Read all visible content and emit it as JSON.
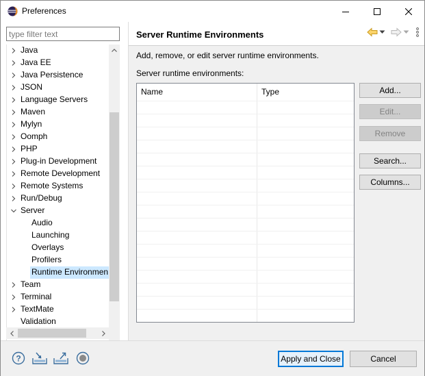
{
  "window": {
    "title": "Preferences",
    "accent": "#0078d7"
  },
  "filter": {
    "placeholder": "type filter text",
    "value": ""
  },
  "tree": {
    "items": [
      {
        "label": "Java",
        "expandable": true
      },
      {
        "label": "Java EE",
        "expandable": true
      },
      {
        "label": "Java Persistence",
        "expandable": true
      },
      {
        "label": "JSON",
        "expandable": true
      },
      {
        "label": "Language Servers",
        "expandable": true
      },
      {
        "label": "Maven",
        "expandable": true
      },
      {
        "label": "Mylyn",
        "expandable": true
      },
      {
        "label": "Oomph",
        "expandable": true
      },
      {
        "label": "PHP",
        "expandable": true
      },
      {
        "label": "Plug-in Development",
        "expandable": true
      },
      {
        "label": "Remote Development",
        "expandable": true
      },
      {
        "label": "Remote Systems",
        "expandable": true
      },
      {
        "label": "Run/Debug",
        "expandable": true
      },
      {
        "label": "Server",
        "expandable": true,
        "expanded": true
      },
      {
        "label": "Audio",
        "child": true
      },
      {
        "label": "Launching",
        "child": true
      },
      {
        "label": "Overlays",
        "child": true
      },
      {
        "label": "Profilers",
        "child": true
      },
      {
        "label": "Runtime Environmen",
        "child": true,
        "selected": true
      },
      {
        "label": "Team",
        "expandable": true
      },
      {
        "label": "Terminal",
        "expandable": true
      },
      {
        "label": "TextMate",
        "expandable": true
      },
      {
        "label": "Validation",
        "expandable": false
      }
    ]
  },
  "page": {
    "title": "Server Runtime Environments",
    "description": "Add, remove, or edit server runtime environments.",
    "list_label": "Server runtime environments:",
    "columns": [
      "Name",
      "Type"
    ],
    "rows": []
  },
  "buttons": {
    "add": "Add...",
    "edit": "Edit...",
    "remove": "Remove",
    "search": "Search...",
    "columns": "Columns..."
  },
  "footer": {
    "apply_close": "Apply and Close",
    "cancel": "Cancel"
  },
  "icons": {
    "help": "help-icon",
    "import": "import-icon",
    "export": "export-icon",
    "record": "record-icon",
    "back": "back-arrow-icon",
    "forward": "forward-arrow-icon",
    "menu": "view-menu-icon"
  }
}
